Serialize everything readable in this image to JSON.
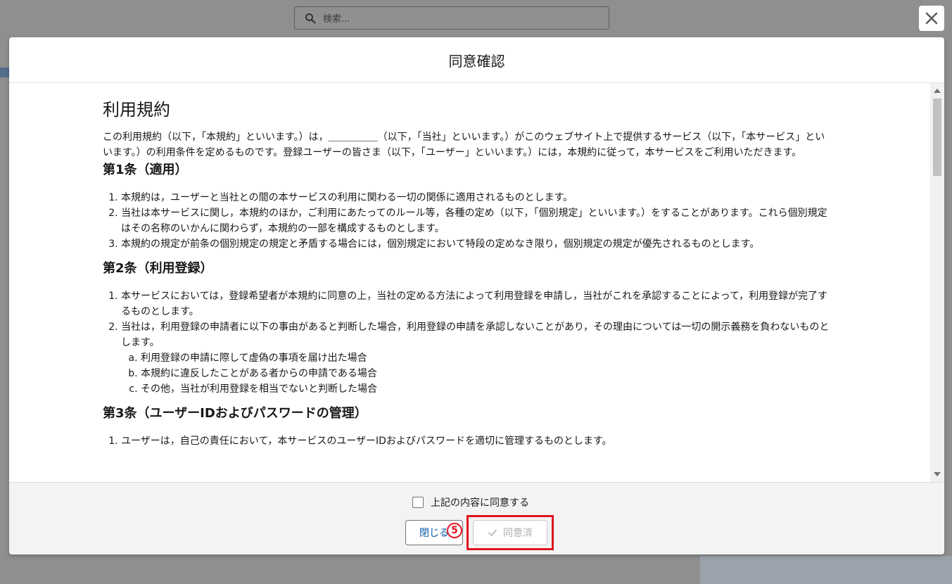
{
  "search": {
    "placeholder": "検索..."
  },
  "modal": {
    "title": "同意確認",
    "terms": {
      "heading": "利用規約",
      "intro": "この利用規約（以下，「本規約」といいます。）は，＿＿＿＿＿（以下，「当社」といいます。）がこのウェブサイト上で提供するサービス（以下，「本サービス」といいます。）の利用条件を定めるものです。登録ユーザーの皆さま（以下，「ユーザー」といいます。）には，本規約に従って，本サービスをご利用いただきます。",
      "sections": [
        {
          "title": "第1条（適用）",
          "items": [
            "本規約は，ユーザーと当社との間の本サービスの利用に関わる一切の関係に適用されるものとします。",
            "当社は本サービスに関し，本規約のほか，ご利用にあたってのルール等，各種の定め（以下，「個別規定」といいます。）をすることがあります。これら個別規定はその名称のいかんに関わらず，本規約の一部を構成するものとします。",
            "本規約の規定が前条の個別規定の規定と矛盾する場合には，個別規定において特段の定めなき限り，個別規定の規定が優先されるものとします。"
          ]
        },
        {
          "title": "第2条（利用登録）",
          "items": [
            "本サービスにおいては，登録希望者が本規約に同意の上，当社の定める方法によって利用登録を申請し，当社がこれを承認することによって，利用登録が完了するものとします。",
            "当社は，利用登録の申請者に以下の事由があると判断した場合，利用登録の申請を承認しないことがあり，その理由については一切の開示義務を負わないものとします。"
          ],
          "subitems": [
            "利用登録の申請に際して虚偽の事項を届け出た場合",
            "本規約に違反したことがある者からの申請である場合",
            "その他，当社が利用登録を相当でないと判断した場合"
          ]
        },
        {
          "title": "第3条（ユーザーIDおよびパスワードの管理）",
          "items": [
            "ユーザーは，自己の責任において，本サービスのユーザーIDおよびパスワードを適切に管理するものとします。"
          ]
        }
      ]
    },
    "footer": {
      "agree_checkbox_label": "上記の内容に同意する",
      "close_label": "閉じる",
      "agreed_label": "同意済",
      "step_marker": "5"
    }
  },
  "colors": {
    "highlight": "#e0141e",
    "link_blue": "#0b5cab"
  }
}
